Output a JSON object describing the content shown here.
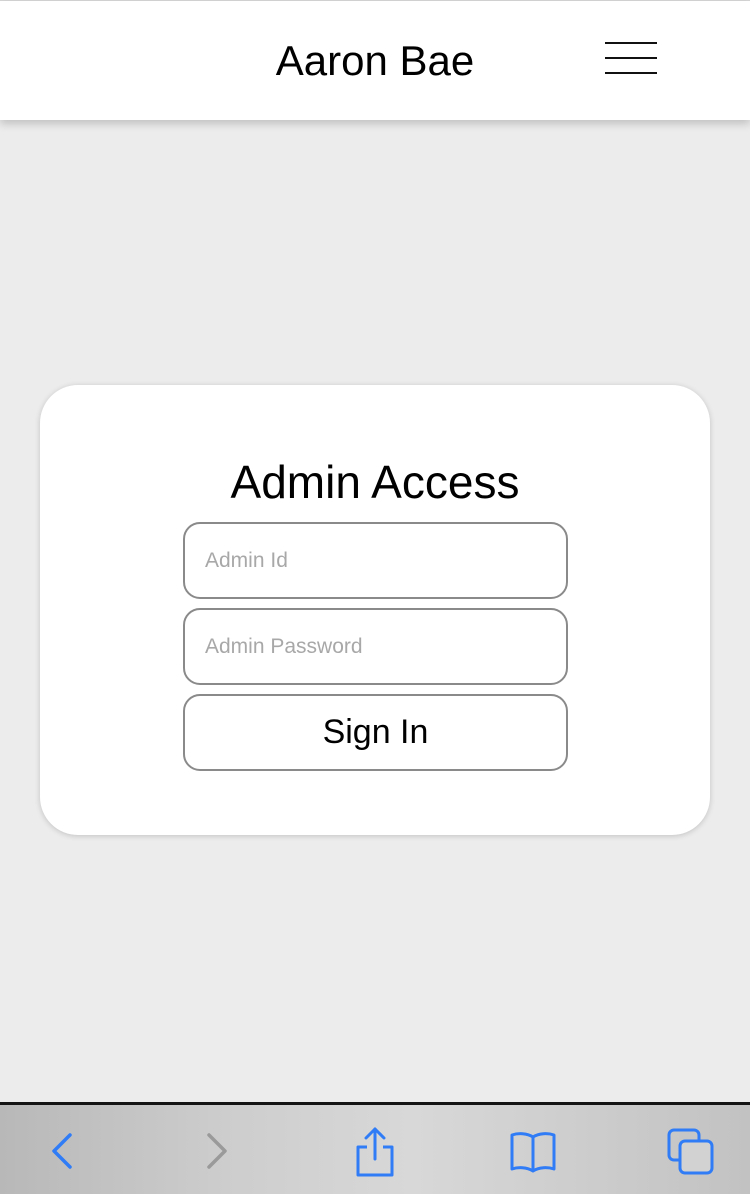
{
  "header": {
    "title": "Aaron Bae",
    "menu_icon": "hamburger-menu-icon"
  },
  "login_card": {
    "title": "Admin Access",
    "admin_id": {
      "value": "",
      "placeholder": "Admin Id"
    },
    "admin_password": {
      "value": "",
      "placeholder": "Admin Password"
    },
    "submit_label": "Sign In"
  },
  "browser_toolbar": {
    "icons": [
      "back-icon",
      "forward-icon",
      "share-icon",
      "bookmarks-icon",
      "tabs-icon"
    ],
    "accent_color": "#2f7cf6",
    "disabled_color": "#9a9a9a"
  }
}
